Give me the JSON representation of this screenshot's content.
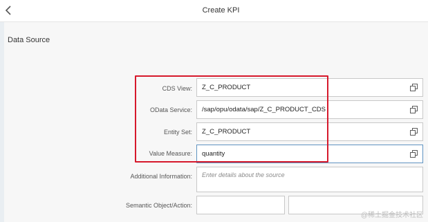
{
  "header": {
    "title": "Create KPI"
  },
  "section": {
    "title": "Data Source"
  },
  "form": {
    "cds_view": {
      "label": "CDS View:",
      "value": "Z_C_PRODUCT"
    },
    "odata_service": {
      "label": "OData Service:",
      "value": "/sap/opu/odata/sap/Z_C_PRODUCT_CDS"
    },
    "entity_set": {
      "label": "Entity Set:",
      "value": "Z_C_PRODUCT"
    },
    "value_measure": {
      "label": "Value Measure:",
      "value": "quantity"
    },
    "additional_info": {
      "label": "Additional Information:",
      "placeholder": "Enter details about the source"
    },
    "semantic_object_action": {
      "label": "Semantic Object/Action:"
    }
  },
  "watermark": "@稀土掘金技术社区",
  "colors": {
    "highlight": "#d6182b",
    "active_border": "#5f93c1"
  },
  "icons": {
    "back": "chevron-left-icon",
    "value_help": "value-help-icon"
  }
}
